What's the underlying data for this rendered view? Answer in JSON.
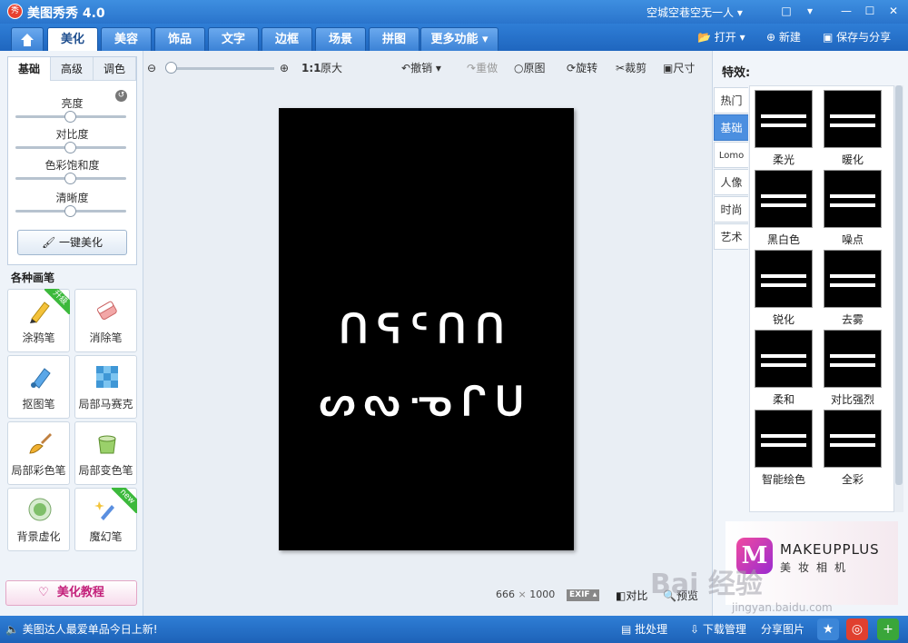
{
  "window": {
    "title": "美图秀秀 4.0",
    "app_icon": "秀",
    "user": "空城空巷空无一人 ▾",
    "controls": [
      "□",
      "▾",
      "—",
      "☐",
      "✕"
    ]
  },
  "nav": {
    "tabs": [
      "美化",
      "美容",
      "饰品",
      "文字",
      "边框",
      "场景",
      "拼图",
      "更多功能 ▾"
    ],
    "active_tab": "美化",
    "open": "打开",
    "new": "新建",
    "save_share": "保存与分享"
  },
  "left": {
    "tabs": [
      "基础",
      "高级",
      "调色"
    ],
    "sliders": [
      {
        "label": "亮度",
        "level": 0.5
      },
      {
        "label": "对比度",
        "level": 0.5
      },
      {
        "label": "色彩饱和度",
        "level": 0.5
      },
      {
        "label": "清晰度",
        "level": 0.5
      }
    ],
    "one_click": "一键美化",
    "brushes_heading": "各种画笔",
    "tools": [
      {
        "label": "涂鸦笔",
        "ribbon": "升级"
      },
      {
        "label": "消除笔",
        "ribbon": ""
      },
      {
        "label": "抠图笔",
        "ribbon": ""
      },
      {
        "label": "局部马赛克",
        "ribbon": ""
      },
      {
        "label": "局部彩色笔",
        "ribbon": ""
      },
      {
        "label": "局部变色笔",
        "ribbon": ""
      },
      {
        "label": "背景虚化",
        "ribbon": ""
      },
      {
        "label": "魔幻笔",
        "ribbon": "new"
      }
    ],
    "tutorial": "美化教程"
  },
  "canvas": {
    "zoom_ratio": "1:1",
    "original_size": "原大",
    "undo": "撤销",
    "redo": "重做",
    "original": "原图",
    "rotate": "旋转",
    "crop": "裁剪",
    "resize": "尺寸",
    "photo_line1": "ᑎᕋᑦᑎᑎ",
    "photo_line2": "ᔕᔓᓉᒋᑌ",
    "image_width": "666",
    "image_height": "1000",
    "size_sep": "×",
    "exif": "EXIF ▴",
    "compare": "对比",
    "preview": "预览"
  },
  "right": {
    "title": "特效:",
    "categories": [
      "热门",
      "基础",
      "Lomo",
      "人像",
      "时尚",
      "艺术"
    ],
    "active_category": "基础",
    "effects": [
      "柔光",
      "暖化",
      "黑白色",
      "噪点",
      "锐化",
      "去雾",
      "柔和",
      "对比强烈",
      "智能绘色",
      "全彩"
    ],
    "ad_title": "MAKEUPPLUS",
    "ad_sub": "美妆相机",
    "ad_logo": "M"
  },
  "watermark": {
    "text": "Bai 经验",
    "url": "jingyan.baidu.com"
  },
  "status": {
    "message": "美图达人最爱单品今日上新!",
    "batch": "批处理",
    "download": "下载管理",
    "share": "分享图片"
  },
  "colors": {
    "title_bar": "#2a74cc",
    "accent": "#4b8fe0",
    "canvas": "#000000"
  }
}
